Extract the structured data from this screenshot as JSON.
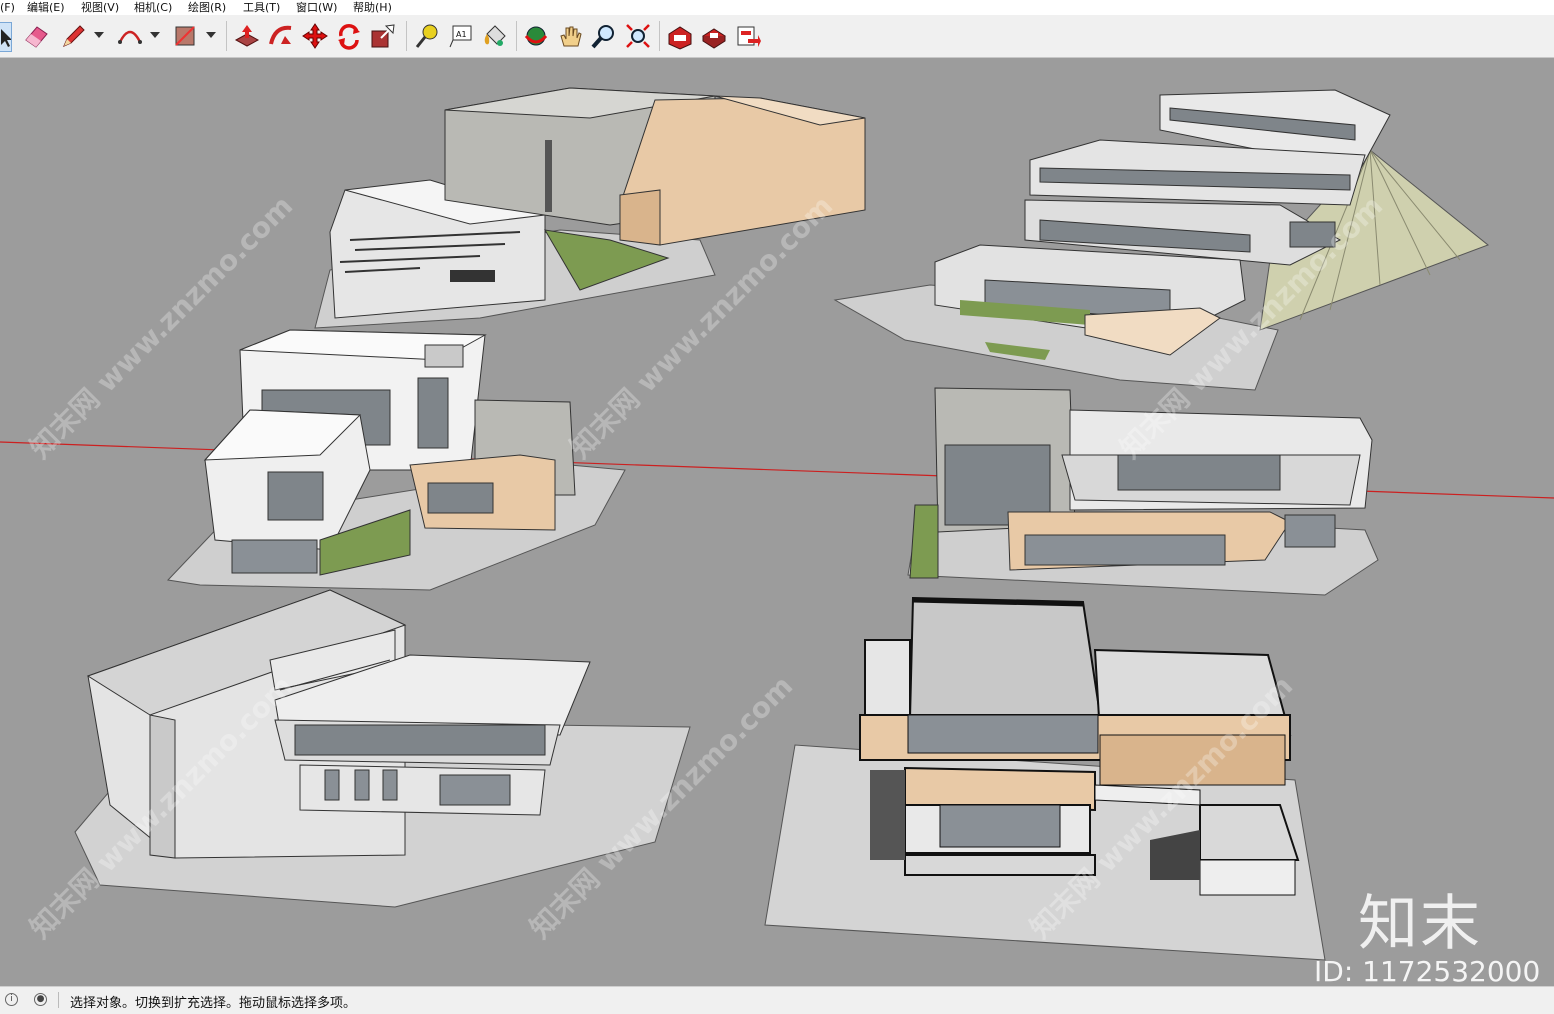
{
  "menu": [
    {
      "label": "(F)"
    },
    {
      "label": "编辑(E)"
    },
    {
      "label": "视图(V)"
    },
    {
      "label": "相机(C)"
    },
    {
      "label": "绘图(R)"
    },
    {
      "label": "工具(T)"
    },
    {
      "label": "窗口(W)"
    },
    {
      "label": "帮助(H)"
    }
  ],
  "toolbar": {
    "tools": [
      {
        "icon": "select-arrow-icon"
      },
      {
        "icon": "eraser-icon"
      },
      {
        "icon": "pencil-line-icon"
      },
      {
        "icon": "arc-icon"
      },
      {
        "icon": "rectangle-shape-icon"
      },
      {
        "icon": "push-pull-icon"
      },
      {
        "icon": "follow-me-icon"
      },
      {
        "icon": "move-icon"
      },
      {
        "icon": "rotate-icon"
      },
      {
        "icon": "scale-icon"
      },
      {
        "icon": "tape-measure-icon"
      },
      {
        "icon": "text-label-icon"
      },
      {
        "icon": "paint-bucket-icon"
      },
      {
        "icon": "orbit-icon"
      },
      {
        "icon": "pan-hand-icon"
      },
      {
        "icon": "zoom-icon"
      },
      {
        "icon": "zoom-extents-icon"
      },
      {
        "icon": "3d-warehouse-icon"
      },
      {
        "icon": "extension-warehouse-icon"
      },
      {
        "icon": "layout-send-icon"
      }
    ],
    "text_tool_label": "A1"
  },
  "watermarks": {
    "site": "知末网 www.znzmo.com",
    "logo": "知末",
    "id": "ID: 1172532000"
  },
  "status": {
    "message": "选择对象。切换到扩充选择。拖动鼠标选择多项。"
  },
  "colors": {
    "viewport_bg": "#9c9c9c",
    "red_axis": "#cc2020",
    "wall_white": "#efefef",
    "concrete": "#b9b9b4",
    "wood": "#e8c9a6",
    "grass": "#7d9b51",
    "glass": "#808890"
  }
}
